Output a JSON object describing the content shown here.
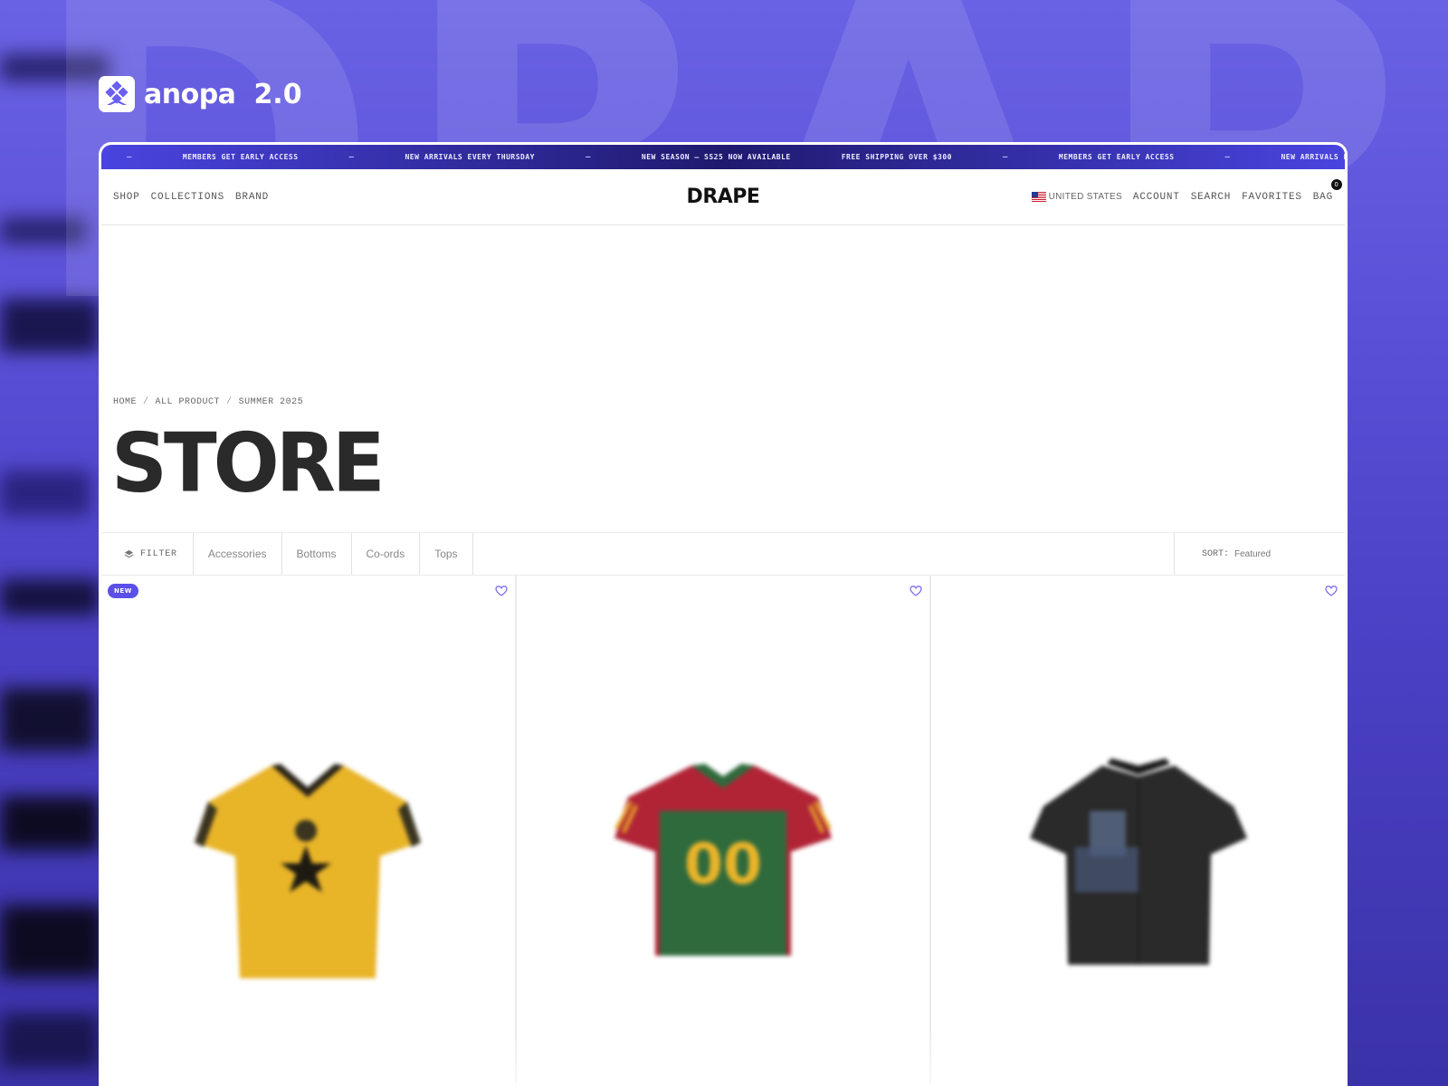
{
  "brand": {
    "name": "anopa",
    "version": "2.0",
    "background_word": "DRAPE"
  },
  "ticker": {
    "items": [
      "MEMBERS GET EARLY ACCESS",
      "NEW ARRIVALS EVERY THURSDAY",
      "NEW SEASON – SS25 NOW AVAILABLE",
      "FREE SHIPPING OVER $300",
      "MEMBERS GET EARLY ACCESS",
      "NEW ARRIVALS EVERY THURSDAY"
    ],
    "separator": "–"
  },
  "nav": {
    "left": [
      "SHOP",
      "COLLECTIONS",
      "BRAND"
    ],
    "logo": "DRAPE",
    "country": "UNITED STATES",
    "right": [
      "ACCOUNT",
      "SEARCH",
      "FAVORITES",
      "BAG"
    ],
    "bag_count": "0"
  },
  "breadcrumb": [
    "HOME",
    "ALL PRODUCT",
    "SUMMER 2025"
  ],
  "page_title": "STORE",
  "filters": {
    "filter_label": "FILTER",
    "categories": [
      "Accessories",
      "Bottoms",
      "Co-ords",
      "Tops"
    ],
    "sort_label": "SORT:",
    "sort_value": "Featured"
  },
  "products": [
    {
      "badge": "NEW",
      "image": "yellow-star-jersey"
    },
    {
      "badge": "",
      "image": "red-green-00-jersey"
    },
    {
      "badge": "",
      "image": "black-graphic-shirt"
    }
  ],
  "colors": {
    "accent": "#5a4fe8",
    "ticker_bg": "#1f1a6e",
    "background": "#5a50d8"
  }
}
